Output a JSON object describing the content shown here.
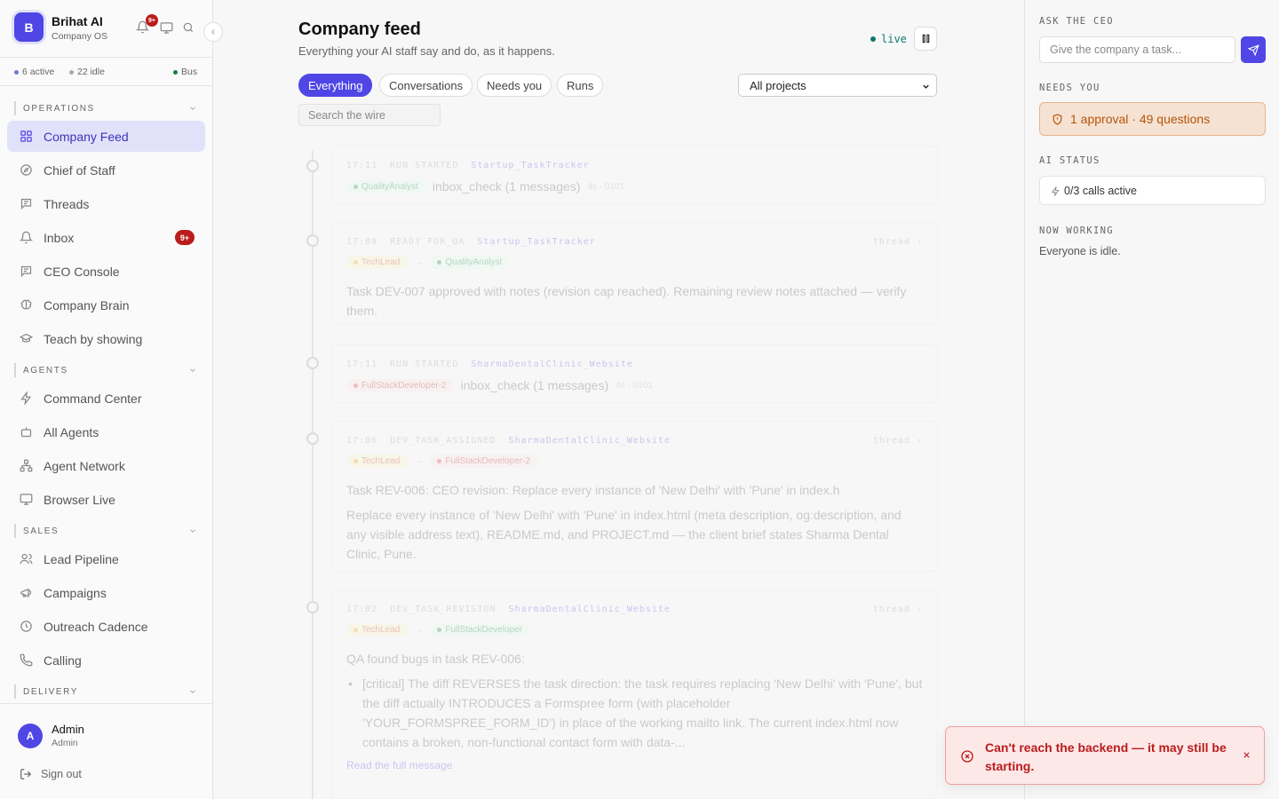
{
  "brand": {
    "initial": "B",
    "name": "Brihat AI",
    "subtitle": "Company OS",
    "notif_badge": "9+"
  },
  "status": {
    "active": "6 active",
    "idle": "22 idle",
    "bus": "Bus"
  },
  "sections": {
    "operations": "OPERATIONS",
    "agents": "AGENTS",
    "sales": "SALES",
    "delivery": "DELIVERY"
  },
  "nav": {
    "operations": [
      {
        "label": "Company Feed",
        "icon": "grid-icon",
        "active": true
      },
      {
        "label": "Chief of Staff",
        "icon": "compass-icon"
      },
      {
        "label": "Threads",
        "icon": "message-icon"
      },
      {
        "label": "Inbox",
        "icon": "bell-icon",
        "badge": "9+"
      },
      {
        "label": "CEO Console",
        "icon": "message-icon"
      },
      {
        "label": "Company Brain",
        "icon": "brain-icon"
      },
      {
        "label": "Teach by showing",
        "icon": "graduation-cap-icon"
      }
    ],
    "agents": [
      {
        "label": "Command Center",
        "icon": "zap-icon"
      },
      {
        "label": "All Agents",
        "icon": "bot-icon"
      },
      {
        "label": "Agent Network",
        "icon": "network-icon"
      },
      {
        "label": "Browser Live",
        "icon": "monitor-icon"
      }
    ],
    "sales": [
      {
        "label": "Lead Pipeline",
        "icon": "users-icon"
      },
      {
        "label": "Campaigns",
        "icon": "megaphone-icon"
      },
      {
        "label": "Outreach Cadence",
        "icon": "clock-icon"
      },
      {
        "label": "Calling",
        "icon": "phone-icon"
      }
    ]
  },
  "user": {
    "initial": "A",
    "name": "Admin",
    "role": "Admin",
    "sign_out": "Sign out"
  },
  "header": {
    "title": "Company feed",
    "subtitle": "Everything your AI staff say and do, as it happens.",
    "live": "live"
  },
  "filters": {
    "tabs": [
      "Everything",
      "Conversations",
      "Needs you",
      "Runs"
    ],
    "project_select": "All projects",
    "search_placeholder": "Search the wire"
  },
  "feed": [
    {
      "time": "17:11",
      "kind": "RUN STARTED",
      "project": "Startup_TaskTracker",
      "agent": "QualityAnalyst",
      "text": "inbox_check (1 messages)",
      "meta": "4s · 0101",
      "color": "green"
    },
    {
      "time": "17:09",
      "kind": "READY_FOR_QA",
      "project": "Startup_TaskTracker",
      "thread": "thread ›",
      "from": "TechLead",
      "to": "QualityAnalyst",
      "body": "Task DEV-007 approved with notes (revision cap reached). Remaining review notes attached — verify them."
    },
    {
      "time": "17:11",
      "kind": "RUN STARTED",
      "project": "SharmaDentalClinic_Website",
      "agent": "FullStackDeveloper-2",
      "text": "inbox_check (1 messages)",
      "meta": "4s · 0101",
      "color": "red"
    },
    {
      "time": "17:06",
      "kind": "DEV_TASK_ASSIGNED",
      "project": "SharmaDentalClinic_Website",
      "thread": "thread ›",
      "from": "TechLead",
      "to": "FullStackDeveloper-2",
      "body": "Task REV-006: CEO revision: Replace every instance of 'New Delhi' with 'Pune' in index.h",
      "body2": "Replace every instance of 'New Delhi' with 'Pune' in index.html (meta description, og:description, and any visible address text), README.md, and PROJECT.md — the client brief states Sharma Dental Clinic, Pune."
    },
    {
      "time": "17:02",
      "kind": "DEV_TASK_REVISION",
      "project": "SharmaDentalClinic_Website",
      "thread": "thread ›",
      "from": "TechLead",
      "to": "FullStackDeveloper",
      "body": "QA found bugs in task REV-006:",
      "bullet": "[critical] The diff REVERSES the task direction: the task requires replacing 'New Delhi' with 'Pune', but the diff actually INTRODUCES a Formspree form (with placeholder 'YOUR_FORMSPREE_FORM_ID') in place of the working mailto link. The current index.html now contains a broken, non-functional contact form with data-...",
      "link": "Read the full message"
    }
  ],
  "right": {
    "ask_label": "ASK THE CEO",
    "ask_placeholder": "Give the company a task...",
    "needs_label": "NEEDS YOU",
    "needs_text": "1 approval · 49 questions",
    "ai_label": "AI STATUS",
    "ai_text": "0/3 calls active",
    "working_label": "NOW WORKING",
    "working_text": "Everyone is idle."
  },
  "toast": {
    "message": "Can't reach the backend — it may still be starting."
  },
  "colors": {
    "accent": "#4f46e5",
    "danger": "#b91c1c",
    "live": "#0f766e",
    "warning": "#b45309"
  }
}
